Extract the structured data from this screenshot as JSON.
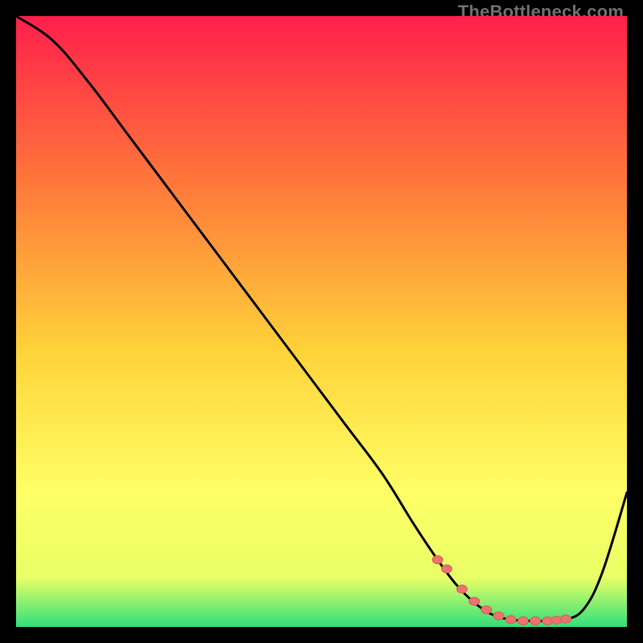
{
  "watermark": "TheBottleneck.com",
  "colors": {
    "gradient_top": "#ff1f4b",
    "gradient_mid1": "#ff7a3a",
    "gradient_mid2": "#ffd33a",
    "gradient_mid3": "#ffff66",
    "gradient_mid4": "#e8ff66",
    "gradient_bottom": "#2fe07a",
    "curve": "#000000",
    "marker_fill": "#e9736d",
    "marker_stroke": "#d85f58"
  },
  "chart_data": {
    "type": "line",
    "title": "",
    "xlabel": "",
    "ylabel": "",
    "xlim": [
      0,
      100
    ],
    "ylim": [
      0,
      100
    ],
    "series": [
      {
        "name": "bottleneck-curve",
        "x": [
          0,
          6,
          12,
          18,
          24,
          30,
          36,
          42,
          48,
          54,
          60,
          65,
          69,
          72,
          75,
          78,
          81,
          84,
          87,
          90,
          93,
          96,
          100
        ],
        "y": [
          100,
          96,
          89,
          81,
          73,
          65,
          57,
          49,
          41,
          33,
          25,
          17,
          11,
          7,
          4,
          2,
          1.2,
          1.0,
          1.0,
          1.2,
          3,
          9,
          22
        ]
      }
    ],
    "markers": {
      "name": "highlight-dots",
      "x": [
        69,
        70.5,
        73,
        75,
        77,
        79,
        81,
        83,
        85,
        87,
        88.5,
        90
      ],
      "y": [
        11,
        9.5,
        6.2,
        4.2,
        2.8,
        1.8,
        1.2,
        1.0,
        1.0,
        1.0,
        1.1,
        1.3
      ]
    }
  }
}
